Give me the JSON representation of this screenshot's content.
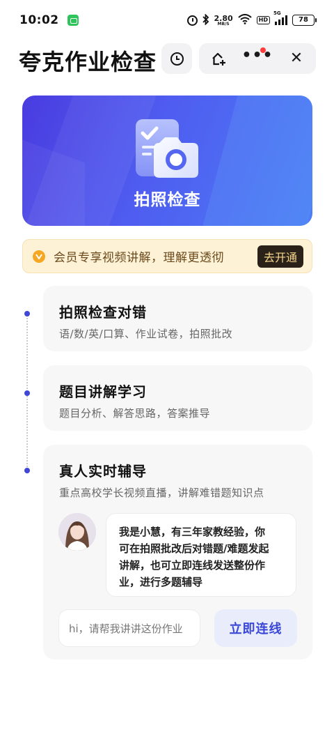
{
  "status_bar": {
    "time": "10:02",
    "net_speed": "2.80",
    "net_unit": "MB/S",
    "hd_label": "HD",
    "signal_label": "5G",
    "battery": "78"
  },
  "header": {
    "title": "夸克作业检查",
    "more_glyph": "•••",
    "close_glyph": "✕"
  },
  "banner": {
    "label": "拍照检查"
  },
  "vip": {
    "text": "会员专享视频讲解，理解更透彻",
    "button": "去开通"
  },
  "features": [
    {
      "title": "拍照检查对错",
      "desc": "语/数/英/口算、作业试卷，拍照批改"
    },
    {
      "title": "题目讲解学习",
      "desc": "题目分析、解答思路，答案推导"
    },
    {
      "title": "真人实时辅导",
      "desc": "重点高校学长视频直播，讲解难错题知识点"
    }
  ],
  "tutor": {
    "message_lines": [
      "我是小慧，有三年家教经验，你",
      "可在拍照批改后对错题/难题发起",
      "讲解，也可立即连线发送整份作",
      "业，进行多题辅导"
    ]
  },
  "ask": {
    "placeholder": "hi，请帮我讲讲这份作业",
    "button": "立即连线"
  },
  "colors": {
    "accent": "#3f46d8",
    "banner_start": "#4a3ce0",
    "banner_end": "#4b7cf5",
    "vip_bg": "#fdf1d6",
    "vip_button_bg": "#2a2218",
    "alert_dot": "#ff3b3b"
  }
}
